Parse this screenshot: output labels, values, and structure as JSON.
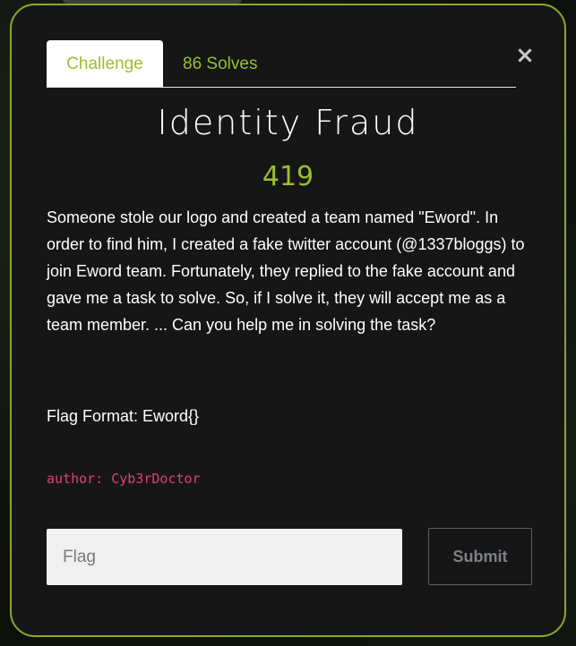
{
  "challenge": {
    "tabs": {
      "challenge_label": "Challenge",
      "solves_label": "86 Solves"
    },
    "close_glyph": "×",
    "title": "Identity Fraud",
    "points": "419",
    "description": "Someone stole our logo and created a team named \"Eword\". In order to find him, I created a fake twitter account (@1337bloggs) to join Eword team. Fortunately, they replied to the fake account and gave me a task to solve. So, if I solve it, they will accept me as a team member. ... Can you help me in solving the task?",
    "flag_format": "Flag Format: Eword{}",
    "author": "author: Cyb3rDoctor",
    "form": {
      "flag_placeholder": "Flag",
      "flag_value": "",
      "submit_label": "Submit"
    }
  },
  "colors": {
    "accent": "#9bbf2e",
    "modal_border": "#8fa72c",
    "modal_background": "#161616",
    "author_text": "#e0407a"
  },
  "icons": {
    "close": "close-icon"
  }
}
